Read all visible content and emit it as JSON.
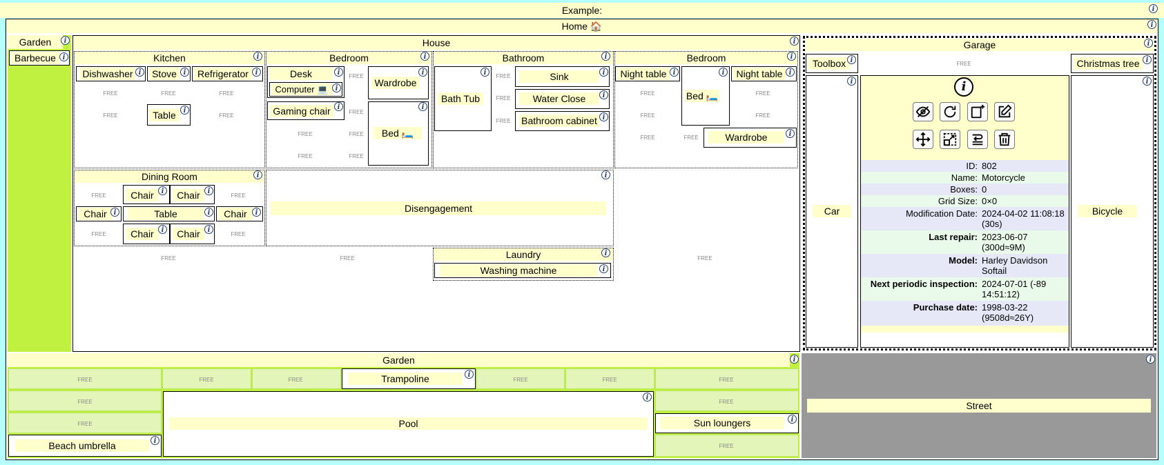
{
  "example_title": "Example:",
  "home": {
    "title": "Home 🏠"
  },
  "garden_top": {
    "title": "Garden",
    "barbecue": "Barbecue"
  },
  "house": {
    "title": "House",
    "kitchen": {
      "title": "Kitchen",
      "dishwasher": "Dishwasher",
      "stove": "Stove",
      "refrigerator": "Refrigerator",
      "table": "Table"
    },
    "bedroom1": {
      "title": "Bedroom",
      "desk": "Desk",
      "computer": "Computer 💻",
      "gaming_chair": "Gaming chair",
      "wardrobe": "Wardrobe",
      "bed": "Bed 🛏️"
    },
    "bathroom": {
      "title": "Bathroom",
      "bath_tub": "Bath Tub",
      "sink": "Sink",
      "water_close": "Water Close",
      "bathroom_cabinet": "Bathroom cabinet"
    },
    "bedroom2": {
      "title": "Bedroom",
      "night_table_1": "Night table",
      "bed": "Bed 🛏️",
      "night_table_2": "Night table",
      "wardrobe": "Wardrobe"
    },
    "dining": {
      "title": "Dining Room",
      "chair": "Chair",
      "table": "Table"
    },
    "disengagement": "Disengagement",
    "laundry": {
      "title": "Laundry",
      "washing_machine": "Washing machine"
    }
  },
  "garage": {
    "title": "Garage",
    "toolbox": "Toolbox",
    "christmas_tree": "Christmas tree",
    "car": "Car",
    "bicycle": "Bicycle",
    "details": {
      "rows": [
        {
          "k": "ID:",
          "v": "802",
          "bold": false
        },
        {
          "k": "Name:",
          "v": "Motorcycle",
          "bold": false
        },
        {
          "k": "Boxes:",
          "v": "0",
          "bold": false
        },
        {
          "k": "Grid Size:",
          "v": "0×0",
          "bold": false
        },
        {
          "k": "Modification Date:",
          "v": "2024-04-02 11:08:18 (30s)",
          "bold": false
        },
        {
          "k": "Last repair:",
          "v": "2023-06-07 (300d≈9M)",
          "bold": true
        },
        {
          "k": "Model:",
          "v": "Harley Davidson Softail",
          "bold": true
        },
        {
          "k": "Next periodic inspection:",
          "v": "2024-07-01 (-89 14:51:12)",
          "bold": true
        },
        {
          "k": "Purchase date:",
          "v": "1998-03-22 (9508d≈26Y)",
          "bold": true
        }
      ]
    }
  },
  "garden_bottom": {
    "title": "Garden",
    "trampoline": "Trampoline",
    "pool": "Pool",
    "sun_loungers": "Sun loungers",
    "beach_umbrella": "Beach umbrella"
  },
  "street": "Street",
  "free_label": "FREE",
  "info_glyph": "i",
  "colors": {
    "background": "#b5fffc",
    "label": "#ffffcc",
    "garden_green": "#c0f040",
    "street_gray": "#999999"
  }
}
